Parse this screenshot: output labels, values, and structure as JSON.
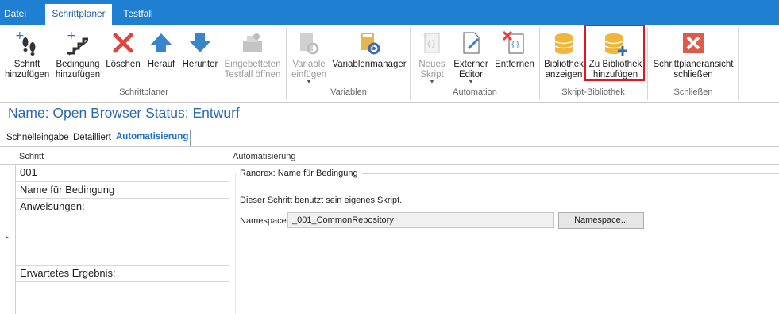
{
  "tabs": [
    {
      "label": "Datei"
    },
    {
      "label": "Schrittplaner"
    },
    {
      "label": "Testfall"
    }
  ],
  "ribbon": {
    "add_step": "Schritt hinzufügen",
    "add_condition": "Bedingung hinzufügen",
    "delete": "Löschen",
    "up": "Herauf",
    "down": "Herunter",
    "embedded_testcase": "Eingebetteten Testfall öffnen",
    "add_variable": "Variable einfügen",
    "variable_manager": "Variablenmanager",
    "new_script": "Neues Skript",
    "external_editor": "Externer Editor",
    "remove": "Entfernen",
    "show_library": "Bibliothek anzeigen",
    "add_to_library": "Zu Bibliothek hinzufügen",
    "close_planner": "Schrittplaneransicht schließen",
    "groups": {
      "schrittplaner": "Schrittplaner",
      "variablen": "Variablen",
      "automation": "Automation",
      "skript_bibliothek": "Skript-Bibliothek",
      "schliessen": "Schließen"
    }
  },
  "header": {
    "title": "Name: Open Browser  Status: Entwurf"
  },
  "view_tabs": [
    "Schnelleingabe",
    "Detailliert",
    "Automatisierung"
  ],
  "grid": {
    "column_header": "Schritt",
    "rows": [
      "001",
      "Name für Bedingung",
      "Anweisungen:",
      "Erwartetes Ergebnis:"
    ]
  },
  "automation": {
    "column_header": "Automatisierung",
    "group_title": "Ranorex: Name für Bedingung",
    "info_text": "Dieser Schritt benutzt sein eigenes Skript.",
    "namespace_label": "Namespace",
    "namespace_value": "_001_CommonRepository",
    "namespace_button": "Namespace..."
  },
  "colors": {
    "tabbar": "#1f7fd2",
    "accent_blue": "#3a84c9",
    "delete_red": "#e0443a",
    "library_gold": "#f0b53a",
    "highlight_red": "#e3131f"
  }
}
